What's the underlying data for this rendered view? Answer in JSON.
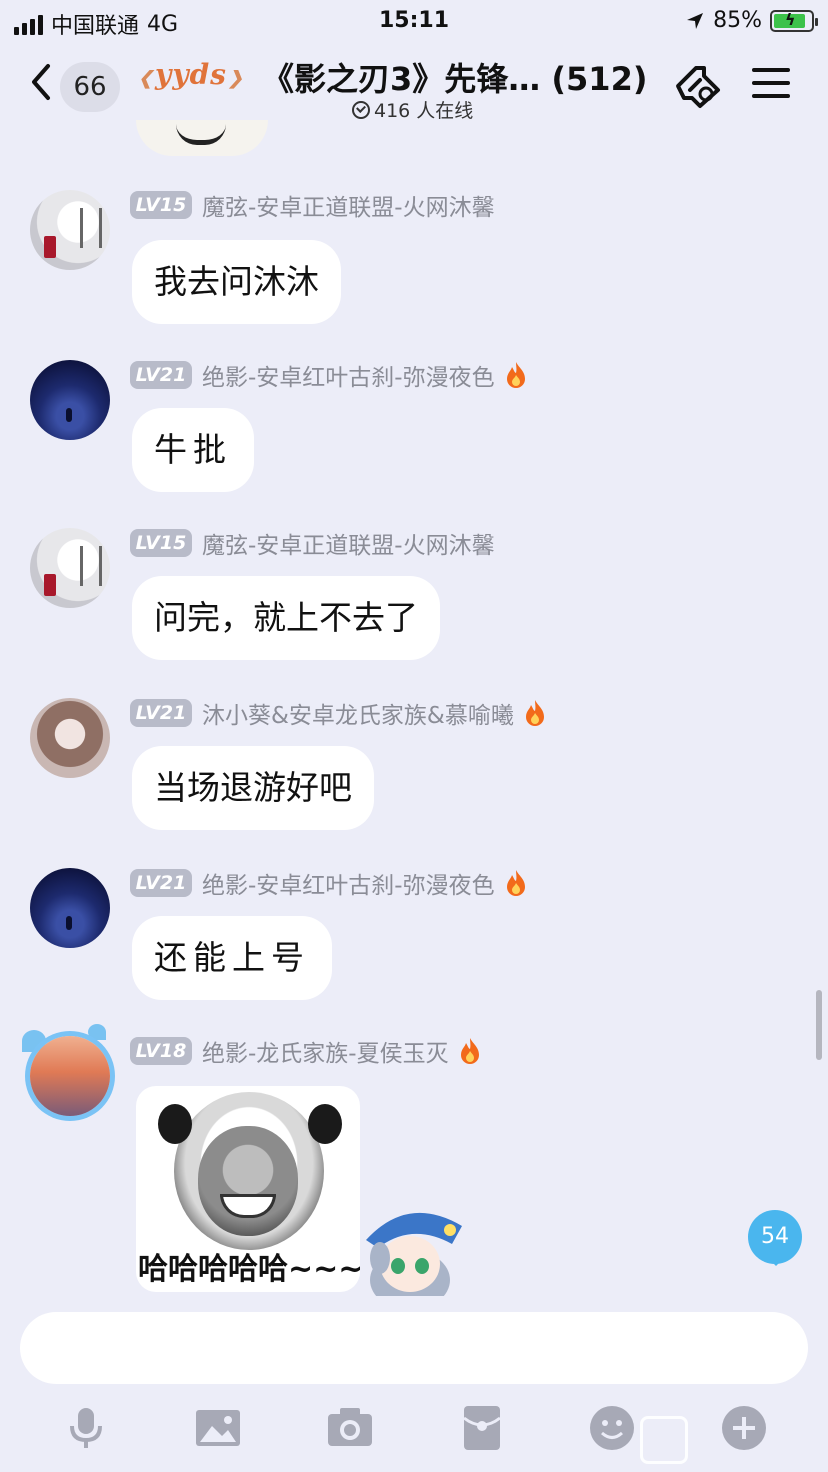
{
  "status_bar": {
    "carrier": "中国联通",
    "network": "4G",
    "time": "15:11",
    "battery": "85%",
    "battery_level": 0.85
  },
  "header": {
    "unread_count": "66",
    "badge_text": "yyds",
    "title": "《影之刃3》先锋…  (512)",
    "online": "416 人在线"
  },
  "messages": [
    {
      "level": "LV15",
      "nickname": "魔弦-安卓正道联盟-火网沐馨",
      "text": "我去问沐沐",
      "fire": false
    },
    {
      "level": "LV21",
      "nickname": "绝影-安卓红叶古刹-弥漫夜色",
      "text": "牛批",
      "fire": true
    },
    {
      "level": "LV15",
      "nickname": "魔弦-安卓正道联盟-火网沐馨",
      "text": "问完，就上不去了",
      "fire": false
    },
    {
      "level": "LV21",
      "nickname": "沐小葵&安卓龙氏家族&慕喻曦",
      "text": "当场退游好吧",
      "fire": true
    },
    {
      "level": "LV21",
      "nickname": "绝影-安卓红叶古刹-弥漫夜色",
      "text": "还能上号",
      "fire": true
    },
    {
      "level": "LV18",
      "nickname": "绝影-龙氏家族-夏侯玉灭",
      "sticker_caption": "哈哈哈哈哈~~~",
      "fire": true
    }
  ],
  "new_message_count": "54",
  "input": {
    "placeholder": ""
  },
  "toolbar": [
    "microphone-icon",
    "image-icon",
    "camera-icon",
    "red-packet-icon",
    "emoji-icon",
    "plus-icon"
  ]
}
